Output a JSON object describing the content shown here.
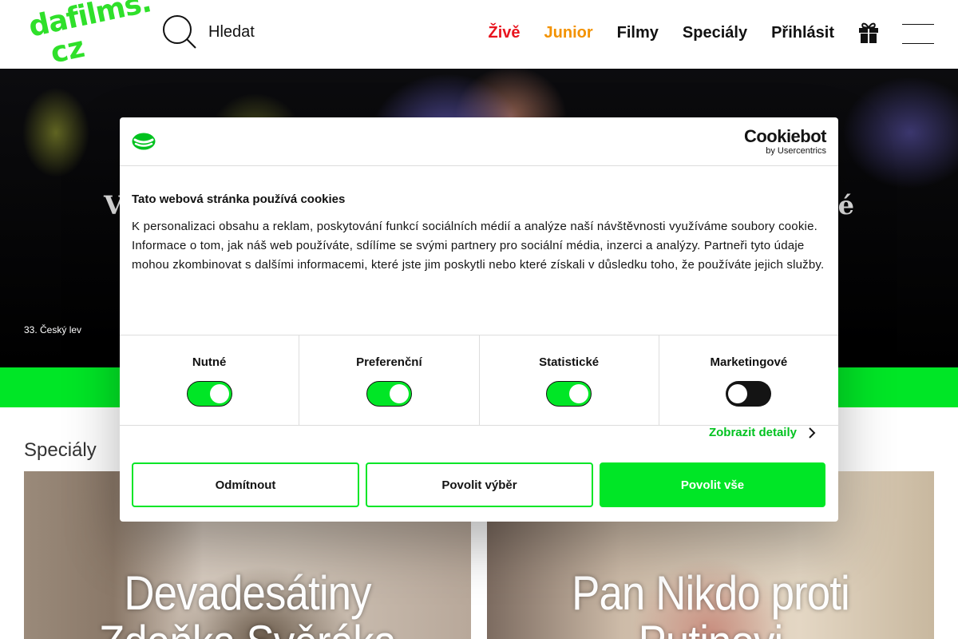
{
  "header": {
    "logo_line1": "dafilms.",
    "logo_line2": "cz",
    "search_label": "Hledat",
    "nav": [
      {
        "label": "Živě",
        "color": "#e8141e"
      },
      {
        "label": "Junior",
        "color": "#f39200"
      },
      {
        "label": "Filmy",
        "color": "#111111"
      },
      {
        "label": "Speciály",
        "color": "#111111"
      },
      {
        "label": "Přihlásit",
        "color": "#111111"
      }
    ]
  },
  "hero": {
    "title_left": "V",
    "title_right": "é",
    "caption": "33. Český lev"
  },
  "specials": {
    "heading": "Speciály",
    "cards": [
      {
        "title": "Devadesátiny Zdeňka Svěráka"
      },
      {
        "title": "Pan Nikdo proti Putinovi"
      }
    ]
  },
  "cookie_dialog": {
    "brand_main": "Cookiebot",
    "brand_sub": "by Usercentrics",
    "title": "Tato webová stránka používá cookies",
    "text": "K personalizaci obsahu a reklam, poskytování funkcí sociálních médií a analýze naší návštěvnosti využíváme soubory cookie. Informace o tom, jak náš web používáte, sdílíme se svými partnery pro sociální média, inzerci a analýzy. Partneři tyto údaje mohou zkombinovat s dalšími informacemi, které jste jim poskytli nebo které získali v důsledku toho, že používáte jejich služby.",
    "toggles": [
      {
        "label": "Nutné",
        "on": true
      },
      {
        "label": "Preferenční",
        "on": true
      },
      {
        "label": "Statistické",
        "on": true
      },
      {
        "label": "Marketingové",
        "on": false
      }
    ],
    "details_link": "Zobrazit detaily",
    "buttons": {
      "decline": "Odmítnout",
      "allow_selection": "Povolit výběr",
      "allow_all": "Povolit vše"
    },
    "accent_color": "#00e626"
  }
}
